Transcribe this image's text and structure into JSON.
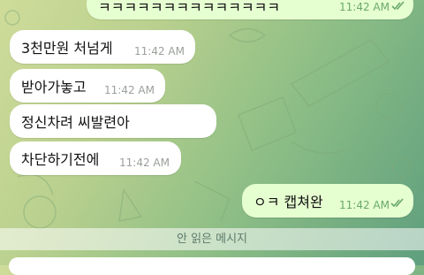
{
  "messages": [
    {
      "text": "ㅋㅋㅋㅋㅋㅋㅋㅋㅋㅋㅋㅋㅋㅋ",
      "time": "11:42 AM"
    },
    {
      "text": "3천만원 처넘게",
      "time": "11:42 AM"
    },
    {
      "text": "받아가놓고",
      "time": "11:42 AM"
    },
    {
      "text": "정신차려 씨발련아",
      "time": "11:42 AM"
    },
    {
      "text": "차단하기전에",
      "time": "11:42 AM"
    },
    {
      "text": "ㅇㅋ 캡쳐완",
      "time": "11:42 AM"
    }
  ],
  "unread_label": "안 읽은 메시지",
  "colors": {
    "outgoing_bubble": "#e6ffd1",
    "incoming_bubble": "#ffffff",
    "read_check": "#6aa86a"
  }
}
